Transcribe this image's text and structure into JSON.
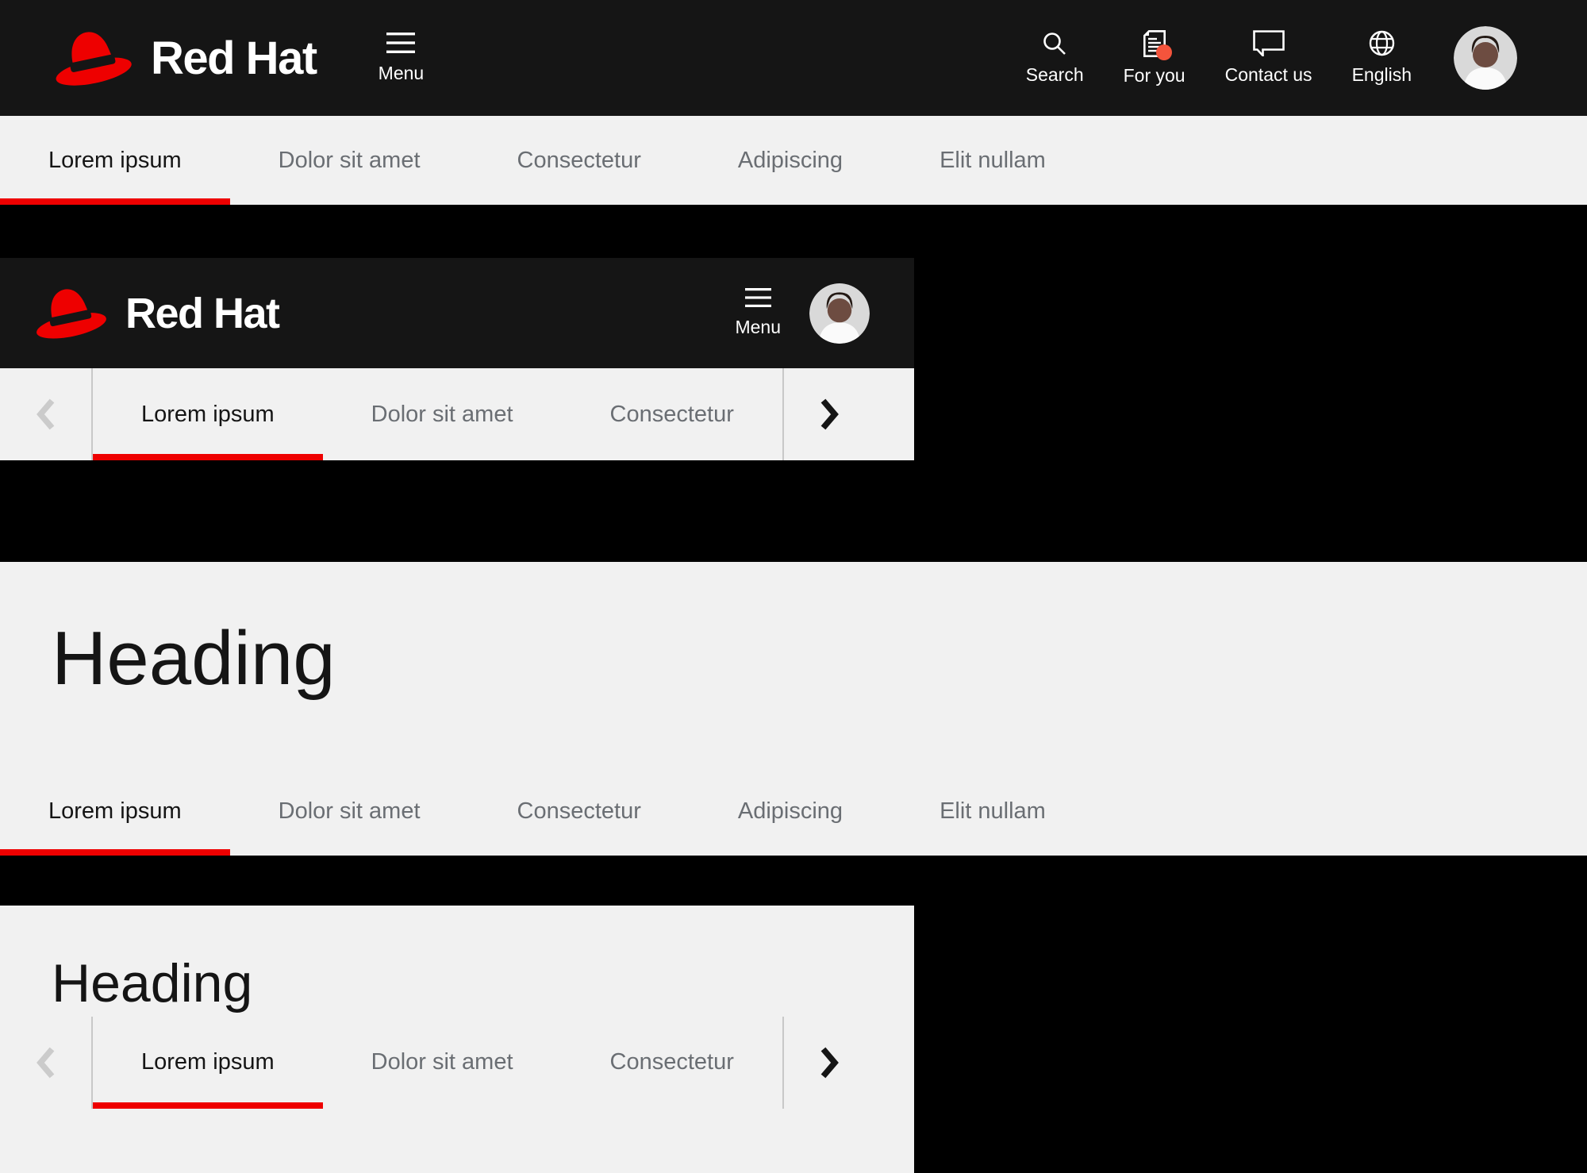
{
  "brand": {
    "logo_text": "Red Hat",
    "logo_icon": "fedora-hat-icon"
  },
  "desktop_header": {
    "menu_label": "Menu",
    "menu_icon": "hamburger-icon",
    "utilities": [
      {
        "label": "Search",
        "icon": "search-icon"
      },
      {
        "label": "For you",
        "icon": "document-icon",
        "badge": true
      },
      {
        "label": "Contact us",
        "icon": "chat-bubble-icon"
      },
      {
        "label": "English",
        "icon": "globe-icon"
      }
    ],
    "avatar_icon": "user-avatar"
  },
  "mobile_header": {
    "menu_label": "Menu",
    "menu_icon": "hamburger-icon",
    "avatar_icon": "user-avatar"
  },
  "desktop_tabs": {
    "items": [
      {
        "label": "Lorem ipsum",
        "active": true
      },
      {
        "label": "Dolor sit amet"
      },
      {
        "label": "Consectetur"
      },
      {
        "label": "Adipiscing"
      },
      {
        "label": "Elit nullam"
      }
    ]
  },
  "mobile_tabs": {
    "items": [
      {
        "label": "Lorem ipsum",
        "active": true
      },
      {
        "label": "Dolor sit amet"
      },
      {
        "label": "Consectetur"
      }
    ],
    "prev": {
      "icon": "chevron-left-icon",
      "enabled": false
    },
    "next": {
      "icon": "chevron-right-icon",
      "enabled": true
    }
  },
  "sections": {
    "desktop_hero_heading": "Heading",
    "mobile_hero_heading": "Heading"
  },
  "colors": {
    "accent": "#ee0000",
    "notification_dot": "#f4543c",
    "header_bg": "#151515",
    "surface": "#f1f1f1",
    "tab_inactive": "#6a6e73",
    "tab_active": "#151515"
  }
}
